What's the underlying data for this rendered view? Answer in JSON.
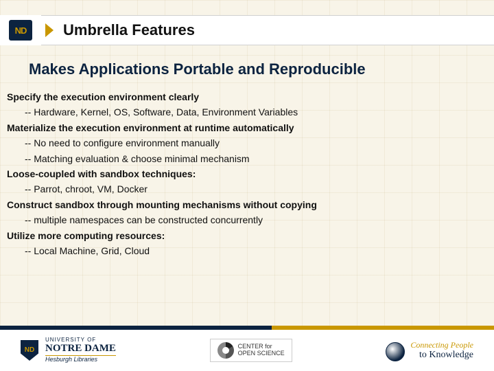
{
  "header": {
    "logo_text": "ND",
    "title": "Umbrella Features"
  },
  "subtitle": "Makes  Applications Portable and Reproducible",
  "sections": [
    {
      "heading": "Specify the execution environment clearly",
      "points": [
        "-- Hardware, Kernel, OS, Software, Data, Environment Variables"
      ]
    },
    {
      "heading": "Materialize the execution environment at runtime automatically",
      "points": [
        "-- No need to configure environment manually",
        "-- Matching evaluation & choose minimal mechanism"
      ]
    },
    {
      "heading": "Loose-coupled with sandbox techniques:",
      "points": [
        "-- Parrot, chroot, VM, Docker"
      ]
    },
    {
      "heading": "Construct sandbox through mounting mechanisms without copying",
      "points": [
        "-- multiple namespaces can be constructed concurrently"
      ]
    },
    {
      "heading": "Utilize more computing resources:",
      "points": [
        "-- Local Machine, Grid, Cloud"
      ]
    }
  ],
  "footer": {
    "nd": {
      "line1": "UNIVERSITY OF",
      "line2": "NOTRE DAME",
      "line3": "Hesburgh Libraries"
    },
    "cos": {
      "line1": "CENTER for",
      "line2": "OPEN SCIENCE"
    },
    "connect": {
      "line1": "Connecting People",
      "line2": "to Knowledge"
    }
  }
}
